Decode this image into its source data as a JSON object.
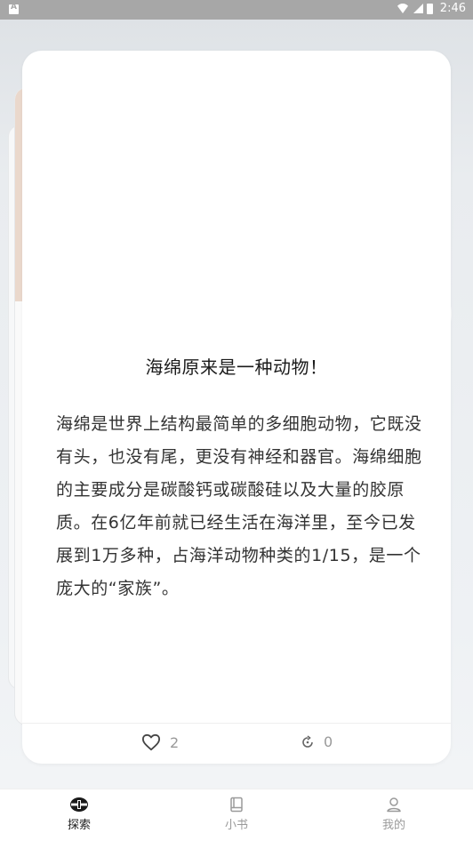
{
  "status_bar": {
    "time": "2:46"
  },
  "card": {
    "title": "海绵原来是一种动物！",
    "body": "海绵是世界上结构最简单的多细胞动物，它既没有头，也没有尾，更没有神经和器官。海绵细胞的主要成分是碳酸钙或碳酸硅以及大量的胶原质。在6亿年前就已经生活在海洋里，至今已发展到1万多种，占海洋动物种类的1/15，是一个庞大的“家族”。",
    "likes": "2",
    "shares": "0"
  },
  "nav": {
    "items": [
      {
        "label": "探索",
        "icon": "explore-icon",
        "active": true
      },
      {
        "label": "小书",
        "icon": "book-icon",
        "active": false
      },
      {
        "label": "我的",
        "icon": "user-icon",
        "active": false
      }
    ]
  },
  "colors": {
    "active": "#222222",
    "inactive": "#9a9a9a"
  }
}
